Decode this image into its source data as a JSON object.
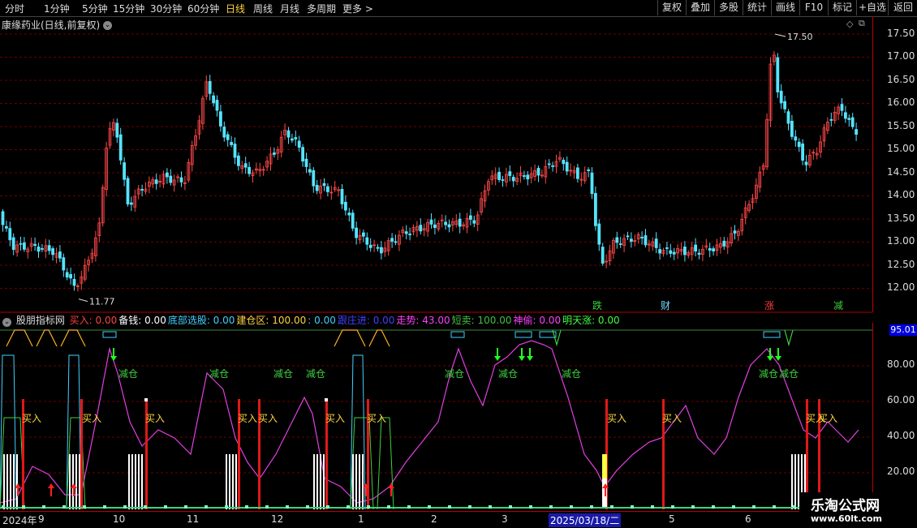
{
  "toolbar": {
    "periods": [
      "分时",
      "1分钟",
      "5分钟",
      "15分钟",
      "30分钟",
      "60分钟",
      "日线",
      "周线",
      "月线",
      "多周期",
      "更多 >"
    ],
    "active": "日线",
    "right_buttons": [
      "复权",
      "叠加",
      "多股",
      "统计",
      "画线",
      "F10",
      "标记",
      "+自选",
      "返回"
    ]
  },
  "main_chart": {
    "title": "康缘药业(日线,前复权)",
    "high_label": "17.50",
    "low_label": "11.77",
    "price_ticks": [
      "17.50",
      "17.00",
      "16.50",
      "16.00",
      "15.50",
      "15.00",
      "14.50",
      "14.00",
      "13.50",
      "13.00",
      "12.50",
      "12.00"
    ],
    "tags": [
      {
        "text": "跌",
        "color": "#3bd13b"
      },
      {
        "text": "财",
        "color": "#6fdcff"
      },
      {
        "text": "涨",
        "color": "#ff3b3b"
      },
      {
        "text": "减",
        "color": "#3bd13b"
      }
    ],
    "colors": {
      "up": "#ff4848",
      "down": "#54e4ff",
      "grid": "#6a0000",
      "axis": "#b00000"
    }
  },
  "indicator": {
    "name": "股朋指标网",
    "items": [
      {
        "label": "买入:",
        "value": "0.00",
        "color": "#ff4040"
      },
      {
        "label": "备钱:",
        "value": "0.00",
        "color": "#ffffff"
      },
      {
        "label": "底部选股:",
        "value": "0.00",
        "color": "#40d0ff"
      },
      {
        "label": "建仓区:",
        "value": "100.00",
        "color": "#ffd33d"
      },
      {
        "label": ":",
        "value": "0.00",
        "color": "#40d0ff"
      },
      {
        "label": "跟庄进:",
        "value": "0.00",
        "color": "#4040ff"
      },
      {
        "label": "走势:",
        "value": "43.00",
        "color": "#ff40ff"
      },
      {
        "label": "短卖:",
        "value": "100.00",
        "color": "#40c040"
      },
      {
        "label": "神偷:",
        "value": "0.00",
        "color": "#ff40ff"
      },
      {
        "label": "明天涨:",
        "value": "0.00",
        "color": "#40ff40"
      }
    ],
    "value_box": "95.01",
    "ticks": [
      "80.00",
      "60.00",
      "40.00",
      "20.00"
    ],
    "buy_label": "买入",
    "reduce_label": "减仓"
  },
  "date_axis": {
    "labels": [
      "2024年",
      "9",
      "10",
      "11",
      "12",
      "1",
      "2",
      "3",
      "2025/03/18/二",
      "5",
      "6"
    ]
  },
  "watermark": {
    "title": "乐淘公式网",
    "url": "www.60lt.com"
  }
}
